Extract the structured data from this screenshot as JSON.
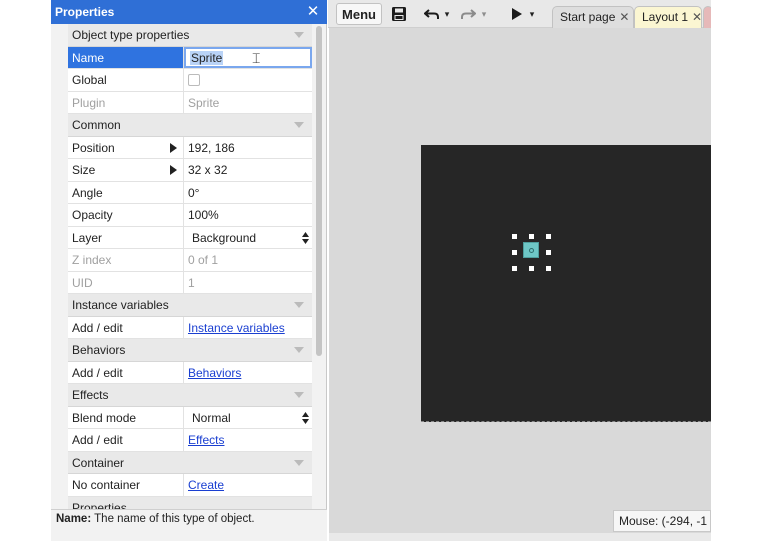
{
  "panel": {
    "title": "Properties",
    "close_icon": "close-icon",
    "rows": [
      {
        "type": "section",
        "label": "Object type properties"
      },
      {
        "type": "prop",
        "key": "Name",
        "value": "Sprite",
        "state": "selected-editing"
      },
      {
        "type": "prop",
        "key": "Global",
        "value": "",
        "control": "checkbox",
        "checked": false
      },
      {
        "type": "prop",
        "key": "Plugin",
        "value": "Sprite",
        "state": "disabled"
      },
      {
        "type": "section",
        "label": "Common"
      },
      {
        "type": "prop",
        "key": "Position",
        "value": "192, 186",
        "expandable": true
      },
      {
        "type": "prop",
        "key": "Size",
        "value": "32 x 32",
        "expandable": true
      },
      {
        "type": "prop",
        "key": "Angle",
        "value": "0°"
      },
      {
        "type": "prop",
        "key": "Opacity",
        "value": "100%"
      },
      {
        "type": "prop",
        "key": "Layer",
        "value": "Background",
        "control": "select"
      },
      {
        "type": "prop",
        "key": "Z index",
        "value": "0 of 1",
        "state": "disabled"
      },
      {
        "type": "prop",
        "key": "UID",
        "value": "1",
        "state": "disabled"
      },
      {
        "type": "section",
        "label": "Instance variables"
      },
      {
        "type": "prop",
        "key": "Add / edit",
        "value": "Instance variables",
        "control": "link"
      },
      {
        "type": "section",
        "label": "Behaviors"
      },
      {
        "type": "prop",
        "key": "Add / edit",
        "value": "Behaviors",
        "control": "link"
      },
      {
        "type": "section",
        "label": "Effects"
      },
      {
        "type": "prop",
        "key": "Blend mode",
        "value": "Normal",
        "control": "select"
      },
      {
        "type": "prop",
        "key": "Add / edit",
        "value": "Effects",
        "control": "link"
      },
      {
        "type": "section",
        "label": "Container"
      },
      {
        "type": "prop",
        "key": "No container",
        "value": "Create",
        "control": "link"
      },
      {
        "type": "section",
        "label": "Properties"
      }
    ],
    "help": {
      "bold": "Name:",
      "text": " The name of this type of object."
    }
  },
  "toolbar": {
    "menu_label": "Menu",
    "tabs": [
      {
        "label": "Start page",
        "active": false
      },
      {
        "label": "Layout 1",
        "active": true
      }
    ]
  },
  "status": {
    "mouse": "Mouse: (-294, -1"
  },
  "colors": {
    "panel_header": "#2f6fd6",
    "selection": "#2f73e0",
    "canvas": "#262626",
    "sprite": "#6ec7c6",
    "active_tab": "#fbf6d2",
    "link": "#1a3fd1"
  }
}
